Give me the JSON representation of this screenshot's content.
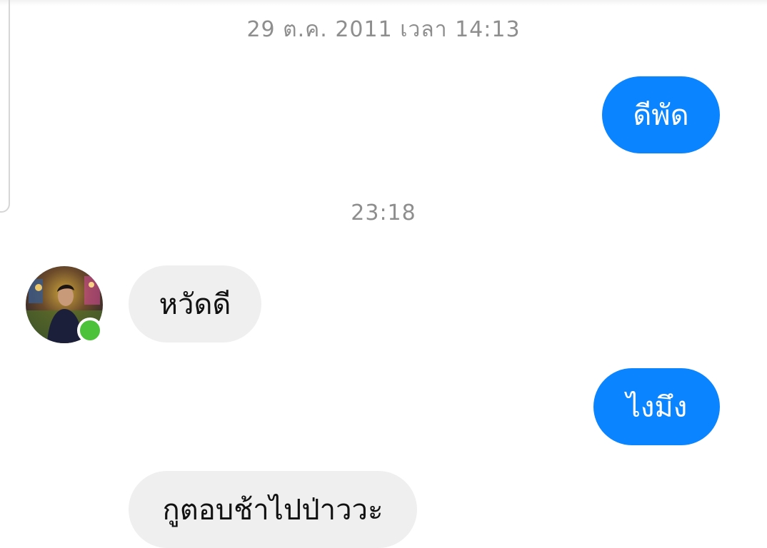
{
  "conversation": {
    "timestamps": {
      "first": "29 ต.ค. 2011 เวลา 14:13",
      "second": "23:18"
    },
    "messages": [
      {
        "direction": "outgoing",
        "text": "ดีพัด"
      },
      {
        "direction": "incoming",
        "text": "หวัดดี"
      },
      {
        "direction": "outgoing",
        "text": "ไงมึง"
      },
      {
        "direction": "incoming",
        "text": "กูตอบช้าไปป่าววะ"
      }
    ],
    "contact": {
      "avatar": "contact-avatar-photo",
      "online_status": "online"
    }
  },
  "colors": {
    "outgoing_bubble": "#0a84ff",
    "incoming_bubble": "#efefef",
    "online_indicator": "#4cc13a",
    "timestamp_text": "#8e8e8e"
  }
}
